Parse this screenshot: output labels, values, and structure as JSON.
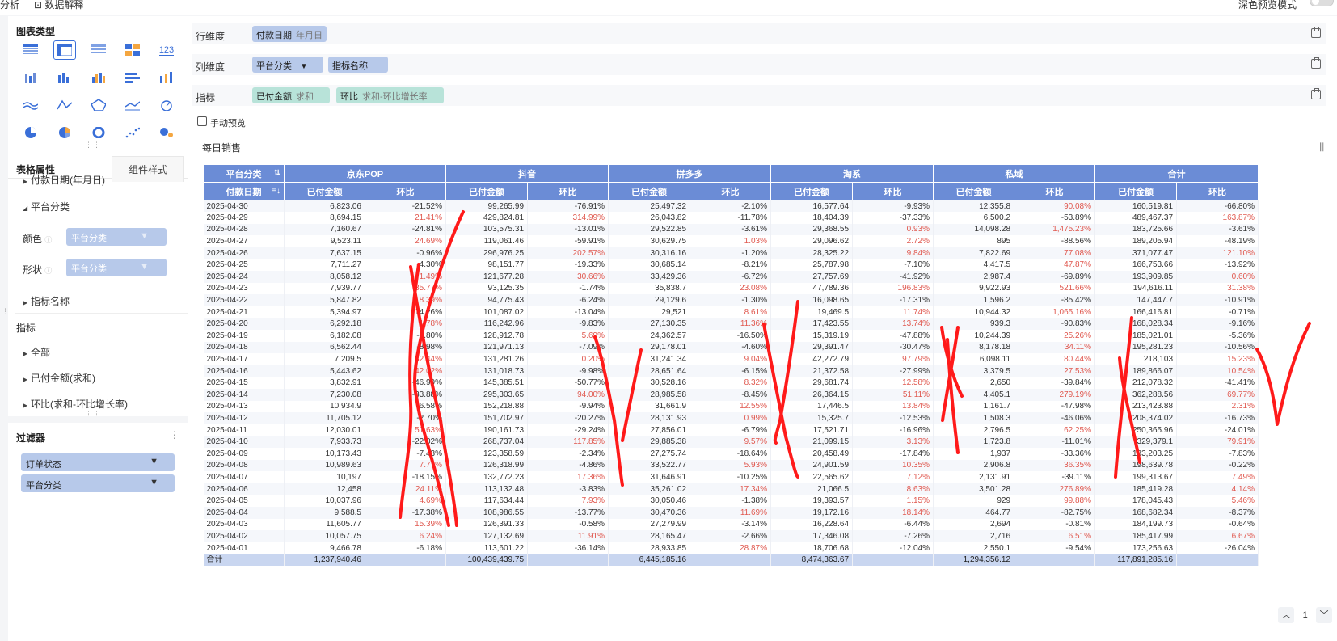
{
  "topbar": {
    "left_label": "分析",
    "data_explain": "数据解释",
    "right_label": "深色预览模式"
  },
  "left": {
    "chart_type_title": "图表类型",
    "chart_type_number_label": "123",
    "tab_active": "表格属性",
    "tab_inactive": "组件样式",
    "tree": {
      "date_field": "付款日期(年月日)",
      "platform": "平台分类",
      "metric_name": "指标名称"
    },
    "color_label": "颜色",
    "shape_label": "形状",
    "color_value": "平台分类",
    "shape_value": "平台分类",
    "metrics_title": "指标",
    "metrics": [
      "全部",
      "已付金额(求和)",
      "环比(求和-环比增长率)"
    ],
    "filter_title": "过滤器",
    "filters": [
      "订单状态",
      "平台分类"
    ]
  },
  "shelves": {
    "row_label": "行维度",
    "row_pill": "付款日期",
    "row_pill_sub": "年月日",
    "col_label": "列维度",
    "col_pill1": "平台分类",
    "col_pill2": "指标名称",
    "metric_label": "指标",
    "metric_pill1": "已付金额",
    "metric_pill1_sub": "求和",
    "metric_pill2": "环比",
    "metric_pill2_sub": "求和-环比增长率"
  },
  "manual_preview": "手动预览",
  "table_title": "每日销售",
  "table": {
    "corner_top": "平台分类",
    "corner_bottom": "付款日期",
    "platforms": [
      "京东POP",
      "抖音",
      "拼多多",
      "淘系",
      "私域",
      "合计"
    ],
    "sub_headers": [
      "已付金额",
      "环比"
    ],
    "rows": [
      [
        "2025-04-30",
        "6,823.06",
        "-21.52%",
        "99,265.99",
        "-76.91%",
        "25,497.32",
        "-2.10%",
        "16,577.64",
        "-9.93%",
        "12,355.8",
        "90.08%",
        "160,519.81",
        "-66.80%"
      ],
      [
        "2025-04-29",
        "8,694.15",
        "21.41%",
        "429,824.81",
        "314.99%",
        "26,043.82",
        "-11.78%",
        "18,404.39",
        "-37.33%",
        "6,500.2",
        "-53.89%",
        "489,467.37",
        "163.87%"
      ],
      [
        "2025-04-28",
        "7,160.67",
        "-24.81%",
        "103,575.31",
        "-13.01%",
        "29,522.85",
        "-3.61%",
        "29,368.55",
        "0.93%",
        "14,098.28",
        "1,475.23%",
        "183,725.66",
        "-3.61%"
      ],
      [
        "2025-04-27",
        "9,523.11",
        "24.69%",
        "119,061.46",
        "-59.91%",
        "30,629.75",
        "1.03%",
        "29,096.62",
        "2.72%",
        "895",
        "-88.56%",
        "189,205.94",
        "-48.19%"
      ],
      [
        "2025-04-26",
        "7,637.15",
        "-0.96%",
        "296,976.25",
        "202.57%",
        "30,316.16",
        "-1.20%",
        "28,325.22",
        "9.84%",
        "7,822.69",
        "77.08%",
        "371,077.47",
        "121.10%"
      ],
      [
        "2025-04-25",
        "7,711.27",
        "-4.30%",
        "98,151.77",
        "-19.33%",
        "30,685.14",
        "-8.21%",
        "25,787.98",
        "-7.10%",
        "4,417.5",
        "47.87%",
        "166,753.66",
        "-13.92%"
      ],
      [
        "2025-04-24",
        "8,058.12",
        "1.49%",
        "121,677.28",
        "30.66%",
        "33,429.36",
        "-6.72%",
        "27,757.69",
        "-41.92%",
        "2,987.4",
        "-69.89%",
        "193,909.85",
        "0.60%"
      ],
      [
        "2025-04-23",
        "7,939.77",
        "35.77%",
        "93,125.35",
        "-1.74%",
        "35,838.7",
        "23.08%",
        "47,789.36",
        "196.83%",
        "9,922.93",
        "521.66%",
        "194,616.11",
        "31.38%"
      ],
      [
        "2025-04-22",
        "5,847.82",
        "8.39%",
        "94,775.43",
        "-6.24%",
        "29,129.6",
        "-1.30%",
        "16,098.65",
        "-17.31%",
        "1,596.2",
        "-85.42%",
        "147,447.7",
        "-10.91%"
      ],
      [
        "2025-04-21",
        "5,394.97",
        "-14.26%",
        "101,087.02",
        "-13.04%",
        "29,521",
        "8.61%",
        "19,469.5",
        "11.74%",
        "10,944.32",
        "1,065.16%",
        "166,416.81",
        "-0.71%"
      ],
      [
        "2025-04-20",
        "6,292.18",
        "1.78%",
        "116,242.96",
        "-9.83%",
        "27,130.35",
        "11.36%",
        "17,423.55",
        "13.74%",
        "939.3",
        "-90.83%",
        "168,028.34",
        "-9.16%"
      ],
      [
        "2025-04-19",
        "6,182.08",
        "-5.80%",
        "128,912.78",
        "5.69%",
        "24,362.57",
        "-16.50%",
        "15,319.19",
        "-47.88%",
        "10,244.39",
        "25.26%",
        "185,021.01",
        "-5.36%"
      ],
      [
        "2025-04-18",
        "6,562.44",
        "-8.98%",
        "121,971.13",
        "-7.09%",
        "29,178.01",
        "-4.60%",
        "29,391.47",
        "-30.47%",
        "8,178.18",
        "34.11%",
        "195,281.23",
        "-10.56%"
      ],
      [
        "2025-04-17",
        "7,209.5",
        "32.44%",
        "131,281.26",
        "0.20%",
        "31,241.34",
        "9.04%",
        "42,272.79",
        "97.79%",
        "6,098.11",
        "80.44%",
        "218,103",
        "15.23%"
      ],
      [
        "2025-04-16",
        "5,443.62",
        "42.02%",
        "131,018.73",
        "-9.98%",
        "28,651.64",
        "-6.15%",
        "21,372.58",
        "-27.99%",
        "3,379.5",
        "27.53%",
        "189,866.07",
        "10.54%"
      ],
      [
        "2025-04-15",
        "3,832.91",
        "-46.99%",
        "145,385.51",
        "-50.77%",
        "30,528.16",
        "8.32%",
        "29,681.74",
        "12.58%",
        "2,650",
        "-39.84%",
        "212,078.32",
        "-41.41%"
      ],
      [
        "2025-04-14",
        "7,230.08",
        "-33.88%",
        "295,303.65",
        "94.00%",
        "28,985.58",
        "-8.45%",
        "26,364.15",
        "51.11%",
        "4,405.1",
        "279.19%",
        "362,288.56",
        "69.77%"
      ],
      [
        "2025-04-13",
        "10,934.9",
        "-6.58%",
        "152,218.88",
        "-9.94%",
        "31,661.9",
        "12.55%",
        "17,446.5",
        "13.84%",
        "1,161.7",
        "-47.98%",
        "213,423.88",
        "2.31%"
      ],
      [
        "2025-04-12",
        "11,705.12",
        "-2.70%",
        "151,702.97",
        "-20.27%",
        "28,131.93",
        "0.99%",
        "15,325.7",
        "-12.53%",
        "1,508.3",
        "-46.06%",
        "208,374.02",
        "-16.73%"
      ],
      [
        "2025-04-11",
        "12,030.01",
        "51.63%",
        "190,161.73",
        "-29.24%",
        "27,856.01",
        "-6.79%",
        "17,521.71",
        "-16.96%",
        "2,796.5",
        "62.25%",
        "250,365.96",
        "-24.01%"
      ],
      [
        "2025-04-10",
        "7,933.73",
        "-22.02%",
        "268,737.04",
        "117.85%",
        "29,885.38",
        "9.57%",
        "21,099.15",
        "3.13%",
        "1,723.8",
        "-11.01%",
        "329,379.1",
        "79.91%"
      ],
      [
        "2025-04-09",
        "10,173.43",
        "-7.43%",
        "123,358.59",
        "-2.34%",
        "27,275.74",
        "-18.64%",
        "20,458.49",
        "-17.84%",
        "1,937",
        "-33.36%",
        "183,203.25",
        "-7.83%"
      ],
      [
        "2025-04-08",
        "10,989.63",
        "7.77%",
        "126,318.99",
        "-4.86%",
        "33,522.77",
        "5.93%",
        "24,901.59",
        "10.35%",
        "2,906.8",
        "36.35%",
        "198,639.78",
        "-0.22%"
      ],
      [
        "2025-04-07",
        "10,197",
        "-18.15%",
        "132,772.23",
        "17.36%",
        "31,646.91",
        "-10.25%",
        "22,565.62",
        "7.12%",
        "2,131.91",
        "-39.11%",
        "199,313.67",
        "7.49%"
      ],
      [
        "2025-04-06",
        "12,458",
        "24.11%",
        "113,132.48",
        "-3.83%",
        "35,261.02",
        "17.34%",
        "21,066.5",
        "8.63%",
        "3,501.28",
        "276.89%",
        "185,419.28",
        "4.14%"
      ],
      [
        "2025-04-05",
        "10,037.96",
        "4.69%",
        "117,634.44",
        "7.93%",
        "30,050.46",
        "-1.38%",
        "19,393.57",
        "1.15%",
        "929",
        "99.88%",
        "178,045.43",
        "5.46%"
      ],
      [
        "2025-04-04",
        "9,588.5",
        "-17.38%",
        "108,986.55",
        "-13.77%",
        "30,470.36",
        "11.69%",
        "19,172.16",
        "18.14%",
        "464.77",
        "-82.75%",
        "168,682.34",
        "-8.37%"
      ],
      [
        "2025-04-03",
        "11,605.77",
        "15.39%",
        "126,391.33",
        "-0.58%",
        "27,279.99",
        "-3.14%",
        "16,228.64",
        "-6.44%",
        "2,694",
        "-0.81%",
        "184,199.73",
        "-0.64%"
      ],
      [
        "2025-04-02",
        "10,057.75",
        "6.24%",
        "127,132.69",
        "11.91%",
        "28,165.47",
        "-2.66%",
        "17,346.08",
        "-7.26%",
        "2,716",
        "6.51%",
        "185,417.99",
        "6.67%"
      ],
      [
        "2025-04-01",
        "9,466.78",
        "-6.18%",
        "113,601.22",
        "-36.14%",
        "28,933.85",
        "28.87%",
        "18,706.68",
        "-12.04%",
        "2,550.1",
        "-9.54%",
        "173,256.63",
        "-26.04%"
      ]
    ],
    "total": [
      "合计",
      "1,237,940.46",
      "",
      "100,439,439.75",
      "",
      "6,445,185.16",
      "",
      "8,474,363.67",
      "",
      "1,294,356.12",
      "",
      "117,891,285.16",
      ""
    ]
  },
  "pager": {
    "page": "1"
  },
  "colors": {
    "header": "#6b8cd6",
    "positive": "#e0584f",
    "pill_blue": "#b7c9ea",
    "pill_teal": "#b8e3d9",
    "annotation": "#ff1a1a"
  }
}
